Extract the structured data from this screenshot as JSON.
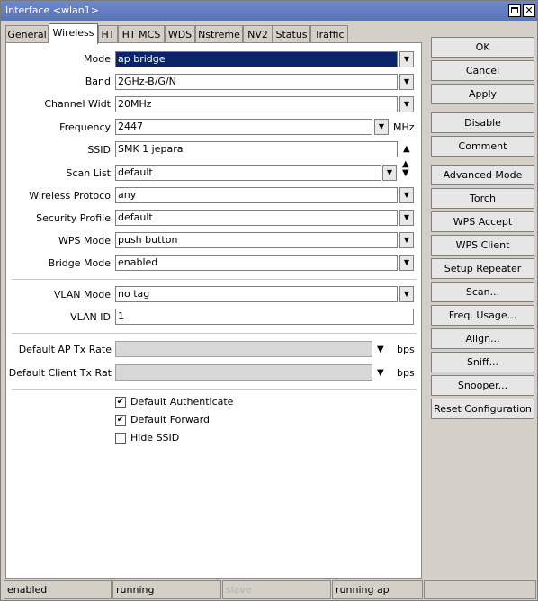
{
  "window": {
    "title": "Interface <wlan1>"
  },
  "tabs": [
    "General",
    "Wireless",
    "HT",
    "HT MCS",
    "WDS",
    "Nstreme",
    "NV2",
    "Status",
    "Traffic"
  ],
  "form": {
    "mode": {
      "label": "Mode",
      "value": "ap bridge"
    },
    "band": {
      "label": "Band",
      "value": "2GHz-B/G/N"
    },
    "channel_width": {
      "label": "Channel Widt",
      "value": "20MHz"
    },
    "frequency": {
      "label": "Frequency",
      "value": "2447",
      "unit": "MHz"
    },
    "ssid": {
      "label": "SSID",
      "value": "SMK 1 jepara"
    },
    "scan_list": {
      "label": "Scan List",
      "value": "default"
    },
    "wireless_protocol": {
      "label": "Wireless Protoco",
      "value": "any"
    },
    "security_profile": {
      "label": "Security Profile",
      "value": "default"
    },
    "wps_mode": {
      "label": "WPS Mode",
      "value": "push button"
    },
    "bridge_mode": {
      "label": "Bridge Mode",
      "value": "enabled"
    },
    "vlan_mode": {
      "label": "VLAN Mode",
      "value": "no tag"
    },
    "vlan_id": {
      "label": "VLAN ID",
      "value": "1"
    },
    "default_ap_tx_rate": {
      "label": "Default AP Tx Rate",
      "value": "",
      "unit": "bps"
    },
    "default_client_tx_rate": {
      "label": "Default Client Tx Rat",
      "value": "",
      "unit": "bps"
    },
    "default_authenticate": {
      "label": "Default Authenticate",
      "checked": true
    },
    "default_forward": {
      "label": "Default Forward",
      "checked": true
    },
    "hide_ssid": {
      "label": "Hide SSID",
      "checked": false
    }
  },
  "buttons": [
    "OK",
    "Cancel",
    "Apply",
    "Disable",
    "Comment",
    "Advanced Mode",
    "Torch",
    "WPS Accept",
    "WPS Client",
    "Setup Repeater",
    "Scan...",
    "Freq. Usage...",
    "Align...",
    "Sniff...",
    "Snooper...",
    "Reset Configuration"
  ],
  "status_bar": [
    "enabled",
    "running",
    "slave",
    "running ap",
    ""
  ]
}
